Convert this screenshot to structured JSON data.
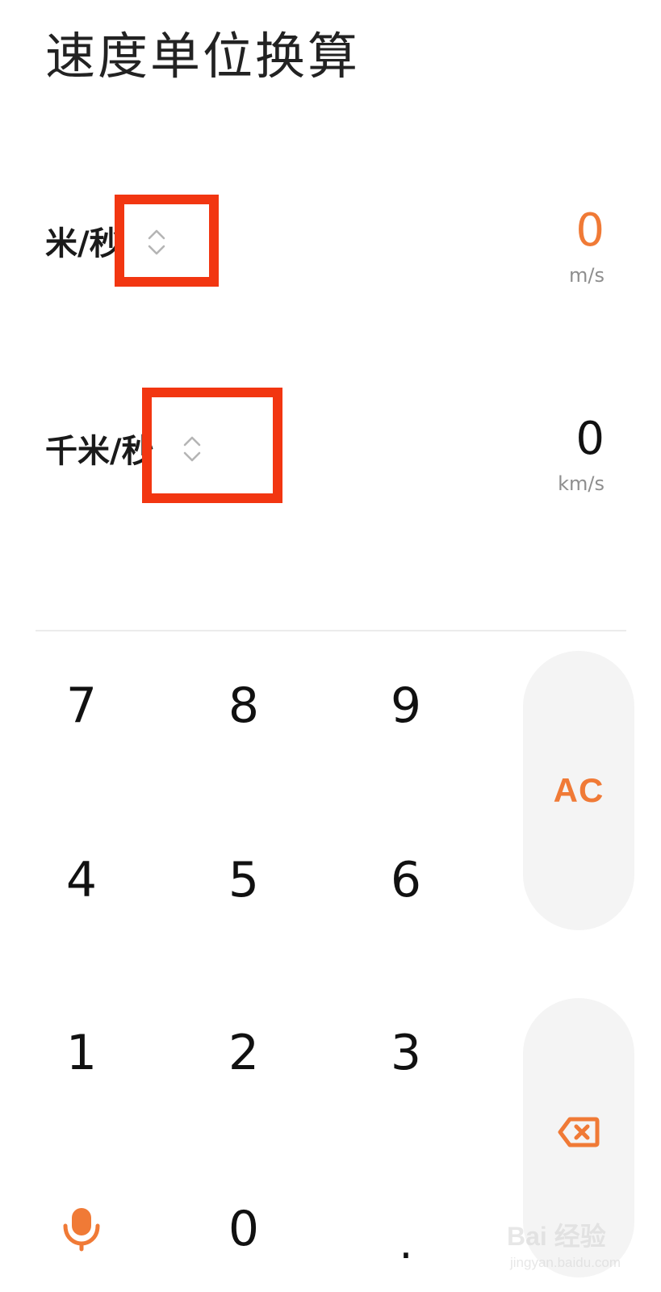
{
  "header": {
    "title": "速度单位换算"
  },
  "converter": {
    "source": {
      "unit_name": "米/秒",
      "value": "0",
      "unit_abbr": "m/s",
      "icon": "chevron-up-down-icon"
    },
    "target": {
      "unit_name": "千米/秒",
      "value": "0",
      "unit_abbr": "km/s",
      "icon": "chevron-up-down-icon"
    }
  },
  "keypad": {
    "digits": [
      "7",
      "8",
      "9",
      "4",
      "5",
      "6",
      "1",
      "2",
      "3"
    ],
    "zero": "0",
    "decimal": ".",
    "clear_label": "AC",
    "backspace_icon": "backspace-icon",
    "voice_icon": "microphone-icon"
  },
  "watermark": {
    "brand": "Bai 经验",
    "url": "jingyan.baidu.com"
  },
  "colors": {
    "accent": "#f07a36",
    "highlight_box": "#f23611",
    "text_primary": "#111111",
    "text_secondary": "#8e8e8e",
    "key_pill_bg": "#f4f4f4"
  }
}
